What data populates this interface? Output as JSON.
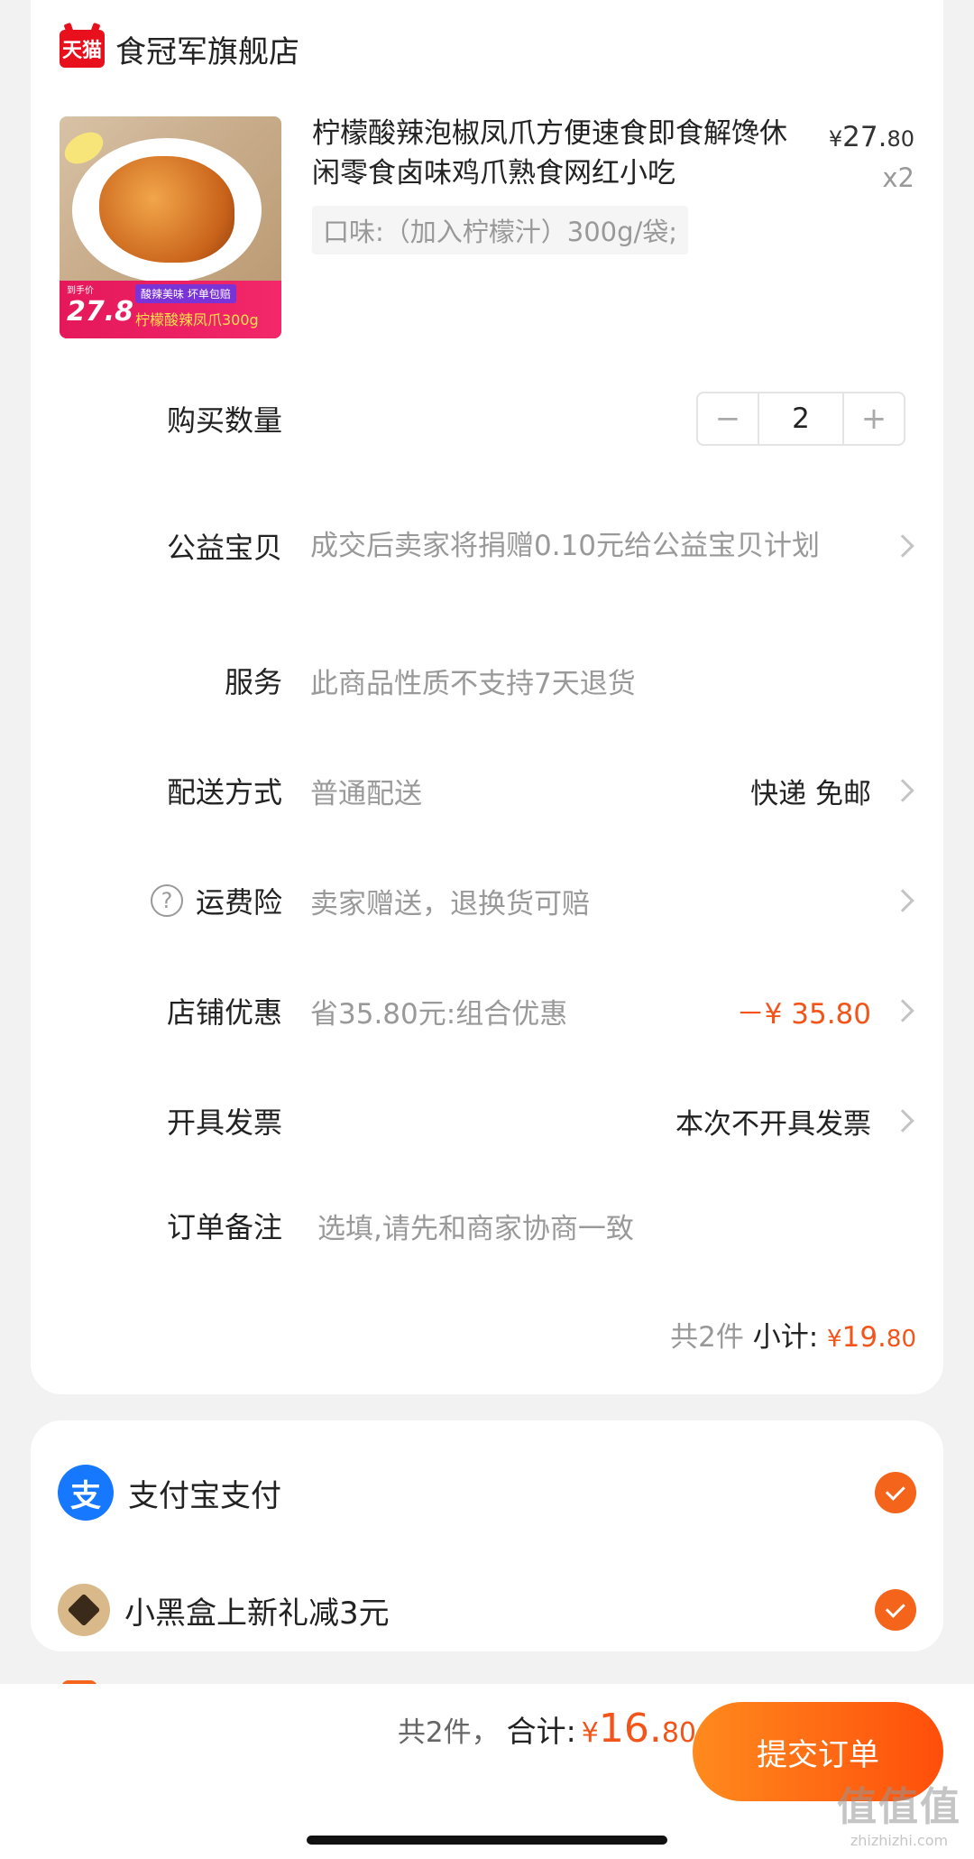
{
  "store": {
    "badge": "天猫",
    "name": "食冠军旗舰店"
  },
  "product": {
    "title": "柠檬酸辣泡椒凤爪方便速食即食解馋休闲零食卤味鸡爪熟食网红小吃",
    "price_yen": "¥",
    "price_int": "27.",
    "price_dec": "80",
    "quantity_label": "x2",
    "sku": "口味:（加入柠檬汁）300g/袋;",
    "image_badge": {
      "label_small": "到手价",
      "price": "27.8",
      "line1": "酸辣美味 坏单包赔",
      "line2": "柠檬酸辣凤爪300g"
    }
  },
  "rows": {
    "quantity": {
      "label": "购买数量",
      "value": "2",
      "minus": "−",
      "plus": "+"
    },
    "charity": {
      "label": "公益宝贝",
      "value": "成交后卖家将捐赠0.10元给公益宝贝计划"
    },
    "service": {
      "label": "服务",
      "value": "此商品性质不支持7天退货"
    },
    "delivery": {
      "label": "配送方式",
      "value": "普通配送",
      "right": "快递 免邮"
    },
    "insurance": {
      "label": "运费险",
      "icon": "?",
      "value": "卖家赠送，退换货可赔"
    },
    "discount": {
      "label": "店铺优惠",
      "value": "省35.80元:组合优惠",
      "right": "－¥ 35.80"
    },
    "invoice": {
      "label": "开具发票",
      "right": "本次不开具发票"
    },
    "note": {
      "label": "订单备注",
      "placeholder": "选填,请先和商家协商一致"
    }
  },
  "subtotal": {
    "count": "共2件",
    "label": "小计:",
    "yen": "¥",
    "int": "19.",
    "dec": "80"
  },
  "payment": {
    "alipay": {
      "icon": "支",
      "label": "支付宝支付"
    },
    "blackbox": {
      "label": "小黑盒上新礼减3元"
    }
  },
  "footer": {
    "count": "共2件，",
    "label": "合计:",
    "yen": "¥",
    "int": "16.",
    "dec": "80",
    "submit": "提交订单",
    "watermark": "值值值",
    "watermark_sub": "zhizhizhi.com"
  },
  "colors": {
    "accent": "#f2541a",
    "alipay": "#1677ff",
    "tmall": "#e8101c"
  }
}
